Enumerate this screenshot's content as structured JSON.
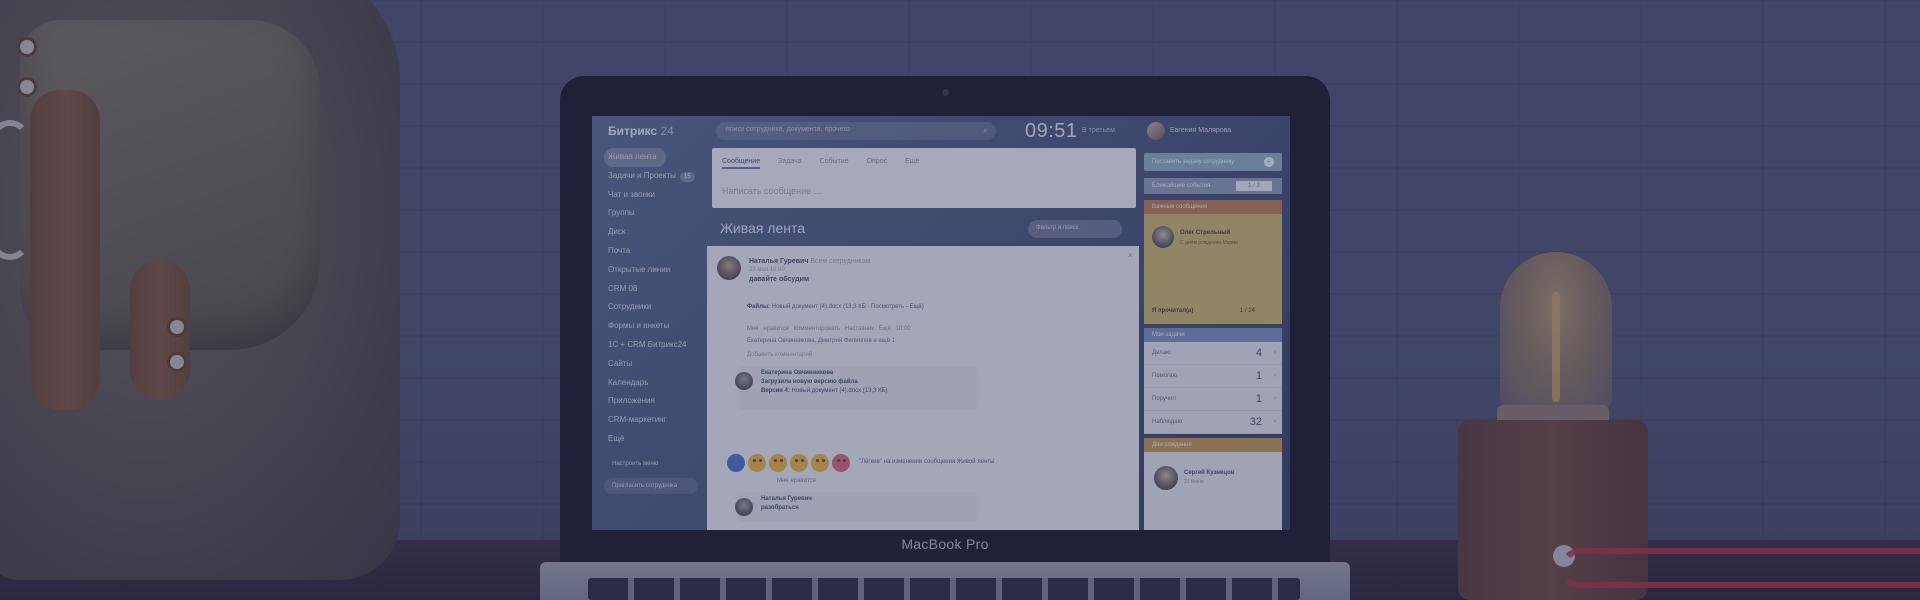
{
  "laptop": {
    "brand": "MacBook Pro"
  },
  "app": {
    "logo_text": "Битрикс",
    "logo_number": "24",
    "search_placeholder": "поиск сотрудника, документа, прочего",
    "clock": "09:51",
    "clock_status": "В третьем",
    "user_name": "Евгения Малярова"
  },
  "nav": {
    "items": [
      {
        "label": "Живая лента",
        "active": true
      },
      {
        "label": "Задачи и Проекты",
        "badge": "15"
      },
      {
        "label": "Чат и звонки"
      },
      {
        "label": "Группы"
      },
      {
        "label": "Диск"
      },
      {
        "label": "Почта"
      },
      {
        "label": "Открытые линии"
      },
      {
        "label": "CRM 08"
      },
      {
        "label": "Сотрудники"
      },
      {
        "label": "Формы и анкеты"
      },
      {
        "label": "1С + CRM Битрикс24"
      },
      {
        "label": "Сайты"
      },
      {
        "label": "Календарь"
      },
      {
        "label": "Приложения"
      },
      {
        "label": "CRM-маркетинг"
      },
      {
        "label": "Ещё"
      }
    ],
    "settings_label": "Настроить меню",
    "invite_label": "Пригласить сотрудника"
  },
  "composer": {
    "tabs": [
      "Сообщение",
      "Задача",
      "Событие",
      "Опрос",
      "Ещё"
    ],
    "placeholder": "Написать сообщение ..."
  },
  "feed": {
    "title": "Живая лента",
    "search_placeholder": "Фильтр и поиск"
  },
  "post": {
    "author": "Наталья Гуревич",
    "to": "Всем сотрудникам",
    "date": "23 мая 10:00",
    "text": "давайте обсудим",
    "files_label": "Файлы:",
    "file_name": "Новый документ (4).docx",
    "file_meta": "(13,3 КБ - Посмотреть - Ещё)",
    "actions": "Мне нравится  Комментировать  Наставник  Ещё  10:00",
    "likes": "Екатерина Овчинникова, Дмитрий Филиппов и ещё 1",
    "add_comment": "Добавить комментарий",
    "comment1": {
      "author": "Екатерина Овчинникова",
      "line1": "Загрузила новую версию файла",
      "line2": "Версия 4:",
      "file": "Новый документ (4).docx",
      "file_meta": "(13,3 КБ)"
    },
    "comment2": {
      "author": "Наталья Гуревич",
      "line1": "разобраться"
    },
    "reaction_text": "\"Лёгкие\" на изменении сообщения Живой ленты",
    "i_like": "Мне нравится"
  },
  "right": {
    "tasks_button": "Поставить задачу сотруднику",
    "calendar_label": "Ближайшие события",
    "calendar_pager": "1 / 2",
    "announcement_header": "Важные сообщения",
    "announcement_name": "Олег Стрельный",
    "announcement_sub": "С днём рождения Марии",
    "announcement_footer": "Я прочитал(а)",
    "announcement_pager": "1 / 24",
    "mytasks_header": "Мои задачи",
    "tasks": [
      {
        "label": "Делаю",
        "count": "4"
      },
      {
        "label": "Помогаю",
        "count": "1"
      },
      {
        "label": "Поручил",
        "count": "1"
      },
      {
        "label": "Наблюдаю",
        "count": "32"
      }
    ],
    "birthdays_header": "Дни рождения",
    "birthday_name": "Сергей Кузнецов",
    "birthday_date": "21 Июня"
  }
}
